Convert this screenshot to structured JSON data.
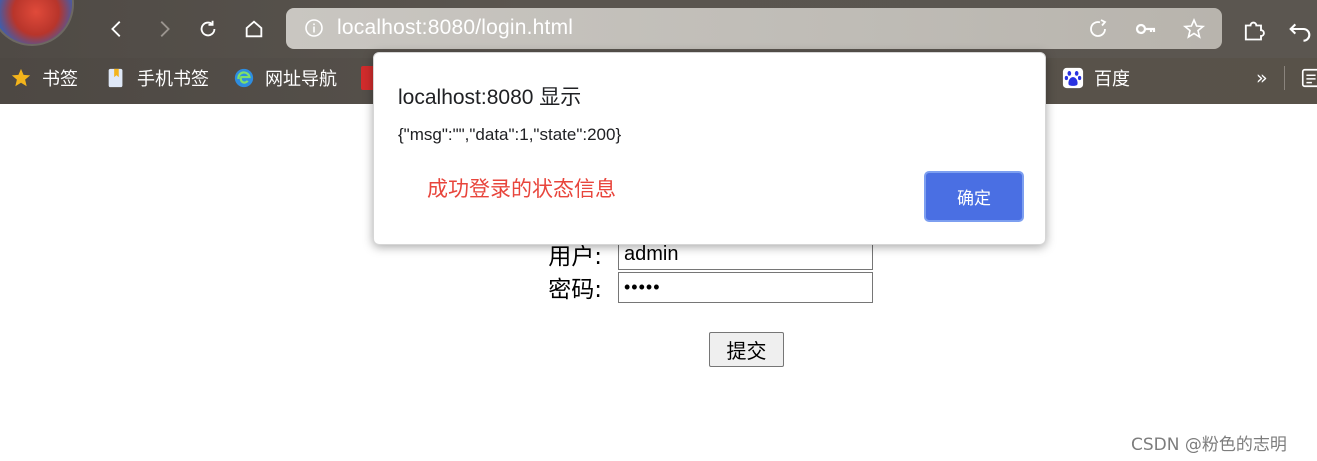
{
  "browser": {
    "url": "localhost:8080/login.html",
    "bookmarks": [
      {
        "label": "书签",
        "icon": "star-icon"
      },
      {
        "label": "手机书签",
        "icon": "phone-bookmark-icon"
      },
      {
        "label": "网址导航",
        "icon": "edge-nav-icon"
      },
      {
        "label": "百度",
        "icon": "baidu-icon"
      }
    ],
    "overflow_label": "»"
  },
  "dialog": {
    "title": "localhost:8080 显示",
    "message": "{\"msg\":\"\",\"data\":1,\"state\":200}",
    "annotation": "成功登录的状态信息",
    "ok_label": "确定",
    "annotation_color": "#e8453c",
    "ok_color": "#4a6fe3"
  },
  "form": {
    "user_label": "用户:",
    "user_value": "admin",
    "password_label": "密码:",
    "password_value": "•••••",
    "submit_label": "提交"
  },
  "watermark": "CSDN @粉色的志明"
}
